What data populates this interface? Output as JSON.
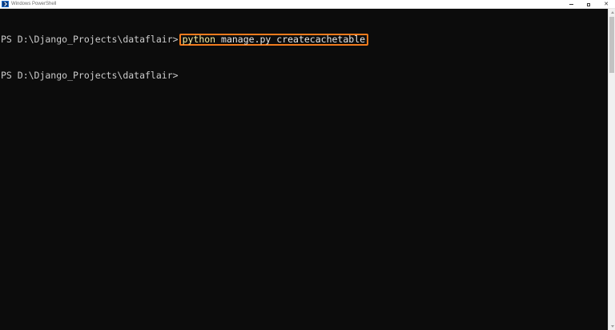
{
  "window": {
    "title": "Windows PowerShell",
    "icon": "powershell-icon"
  },
  "controls": {
    "minimize_icon": "minimize-icon",
    "maximize_icon": "maximize-icon",
    "close_icon": "close-icon"
  },
  "console": {
    "lines": [
      {
        "prompt": "PS D:\\Django_Projects\\dataflair>",
        "command": {
          "keyword": "python",
          "args": " manage.py createcachetable"
        }
      },
      {
        "prompt": "PS D:\\Django_Projects\\dataflair>"
      }
    ]
  },
  "colors": {
    "background": "#0c0c0c",
    "text": "#cccccc",
    "keyword": "#f9f1a5",
    "highlight_border": "#f07b1d"
  }
}
